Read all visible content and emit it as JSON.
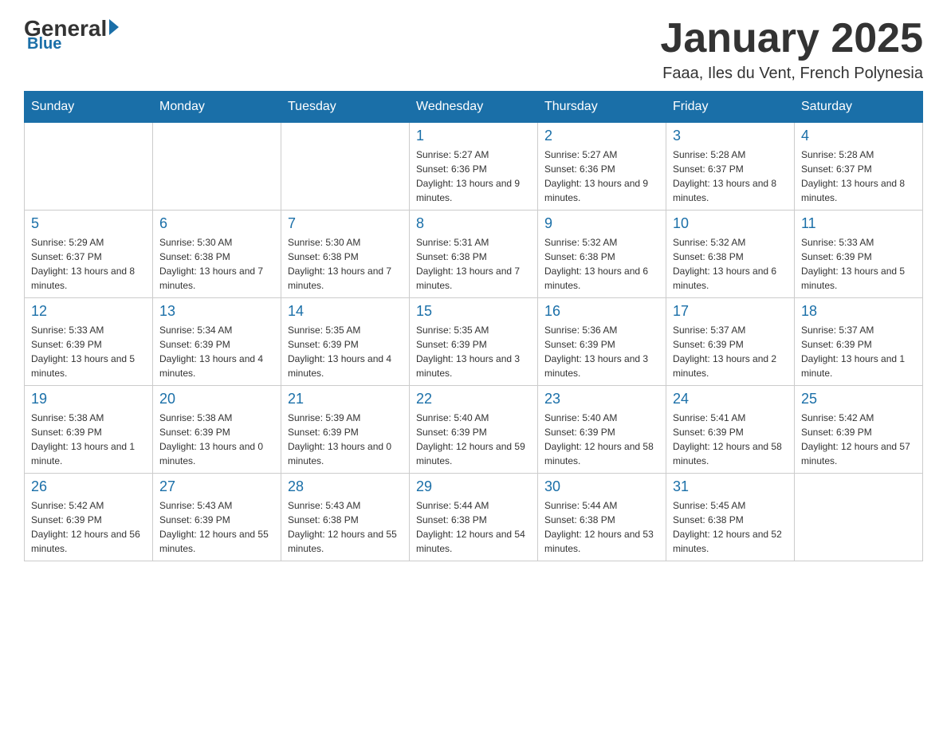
{
  "header": {
    "logo_general": "General",
    "logo_blue": "Blue",
    "month_title": "January 2025",
    "location": "Faaa, Iles du Vent, French Polynesia"
  },
  "days_of_week": [
    "Sunday",
    "Monday",
    "Tuesday",
    "Wednesday",
    "Thursday",
    "Friday",
    "Saturday"
  ],
  "weeks": [
    [
      {
        "day": "",
        "sunrise": "",
        "sunset": "",
        "daylight": ""
      },
      {
        "day": "",
        "sunrise": "",
        "sunset": "",
        "daylight": ""
      },
      {
        "day": "",
        "sunrise": "",
        "sunset": "",
        "daylight": ""
      },
      {
        "day": "1",
        "sunrise": "Sunrise: 5:27 AM",
        "sunset": "Sunset: 6:36 PM",
        "daylight": "Daylight: 13 hours and 9 minutes."
      },
      {
        "day": "2",
        "sunrise": "Sunrise: 5:27 AM",
        "sunset": "Sunset: 6:36 PM",
        "daylight": "Daylight: 13 hours and 9 minutes."
      },
      {
        "day": "3",
        "sunrise": "Sunrise: 5:28 AM",
        "sunset": "Sunset: 6:37 PM",
        "daylight": "Daylight: 13 hours and 8 minutes."
      },
      {
        "day": "4",
        "sunrise": "Sunrise: 5:28 AM",
        "sunset": "Sunset: 6:37 PM",
        "daylight": "Daylight: 13 hours and 8 minutes."
      }
    ],
    [
      {
        "day": "5",
        "sunrise": "Sunrise: 5:29 AM",
        "sunset": "Sunset: 6:37 PM",
        "daylight": "Daylight: 13 hours and 8 minutes."
      },
      {
        "day": "6",
        "sunrise": "Sunrise: 5:30 AM",
        "sunset": "Sunset: 6:38 PM",
        "daylight": "Daylight: 13 hours and 7 minutes."
      },
      {
        "day": "7",
        "sunrise": "Sunrise: 5:30 AM",
        "sunset": "Sunset: 6:38 PM",
        "daylight": "Daylight: 13 hours and 7 minutes."
      },
      {
        "day": "8",
        "sunrise": "Sunrise: 5:31 AM",
        "sunset": "Sunset: 6:38 PM",
        "daylight": "Daylight: 13 hours and 7 minutes."
      },
      {
        "day": "9",
        "sunrise": "Sunrise: 5:32 AM",
        "sunset": "Sunset: 6:38 PM",
        "daylight": "Daylight: 13 hours and 6 minutes."
      },
      {
        "day": "10",
        "sunrise": "Sunrise: 5:32 AM",
        "sunset": "Sunset: 6:38 PM",
        "daylight": "Daylight: 13 hours and 6 minutes."
      },
      {
        "day": "11",
        "sunrise": "Sunrise: 5:33 AM",
        "sunset": "Sunset: 6:39 PM",
        "daylight": "Daylight: 13 hours and 5 minutes."
      }
    ],
    [
      {
        "day": "12",
        "sunrise": "Sunrise: 5:33 AM",
        "sunset": "Sunset: 6:39 PM",
        "daylight": "Daylight: 13 hours and 5 minutes."
      },
      {
        "day": "13",
        "sunrise": "Sunrise: 5:34 AM",
        "sunset": "Sunset: 6:39 PM",
        "daylight": "Daylight: 13 hours and 4 minutes."
      },
      {
        "day": "14",
        "sunrise": "Sunrise: 5:35 AM",
        "sunset": "Sunset: 6:39 PM",
        "daylight": "Daylight: 13 hours and 4 minutes."
      },
      {
        "day": "15",
        "sunrise": "Sunrise: 5:35 AM",
        "sunset": "Sunset: 6:39 PM",
        "daylight": "Daylight: 13 hours and 3 minutes."
      },
      {
        "day": "16",
        "sunrise": "Sunrise: 5:36 AM",
        "sunset": "Sunset: 6:39 PM",
        "daylight": "Daylight: 13 hours and 3 minutes."
      },
      {
        "day": "17",
        "sunrise": "Sunrise: 5:37 AM",
        "sunset": "Sunset: 6:39 PM",
        "daylight": "Daylight: 13 hours and 2 minutes."
      },
      {
        "day": "18",
        "sunrise": "Sunrise: 5:37 AM",
        "sunset": "Sunset: 6:39 PM",
        "daylight": "Daylight: 13 hours and 1 minute."
      }
    ],
    [
      {
        "day": "19",
        "sunrise": "Sunrise: 5:38 AM",
        "sunset": "Sunset: 6:39 PM",
        "daylight": "Daylight: 13 hours and 1 minute."
      },
      {
        "day": "20",
        "sunrise": "Sunrise: 5:38 AM",
        "sunset": "Sunset: 6:39 PM",
        "daylight": "Daylight: 13 hours and 0 minutes."
      },
      {
        "day": "21",
        "sunrise": "Sunrise: 5:39 AM",
        "sunset": "Sunset: 6:39 PM",
        "daylight": "Daylight: 13 hours and 0 minutes."
      },
      {
        "day": "22",
        "sunrise": "Sunrise: 5:40 AM",
        "sunset": "Sunset: 6:39 PM",
        "daylight": "Daylight: 12 hours and 59 minutes."
      },
      {
        "day": "23",
        "sunrise": "Sunrise: 5:40 AM",
        "sunset": "Sunset: 6:39 PM",
        "daylight": "Daylight: 12 hours and 58 minutes."
      },
      {
        "day": "24",
        "sunrise": "Sunrise: 5:41 AM",
        "sunset": "Sunset: 6:39 PM",
        "daylight": "Daylight: 12 hours and 58 minutes."
      },
      {
        "day": "25",
        "sunrise": "Sunrise: 5:42 AM",
        "sunset": "Sunset: 6:39 PM",
        "daylight": "Daylight: 12 hours and 57 minutes."
      }
    ],
    [
      {
        "day": "26",
        "sunrise": "Sunrise: 5:42 AM",
        "sunset": "Sunset: 6:39 PM",
        "daylight": "Daylight: 12 hours and 56 minutes."
      },
      {
        "day": "27",
        "sunrise": "Sunrise: 5:43 AM",
        "sunset": "Sunset: 6:39 PM",
        "daylight": "Daylight: 12 hours and 55 minutes."
      },
      {
        "day": "28",
        "sunrise": "Sunrise: 5:43 AM",
        "sunset": "Sunset: 6:38 PM",
        "daylight": "Daylight: 12 hours and 55 minutes."
      },
      {
        "day": "29",
        "sunrise": "Sunrise: 5:44 AM",
        "sunset": "Sunset: 6:38 PM",
        "daylight": "Daylight: 12 hours and 54 minutes."
      },
      {
        "day": "30",
        "sunrise": "Sunrise: 5:44 AM",
        "sunset": "Sunset: 6:38 PM",
        "daylight": "Daylight: 12 hours and 53 minutes."
      },
      {
        "day": "31",
        "sunrise": "Sunrise: 5:45 AM",
        "sunset": "Sunset: 6:38 PM",
        "daylight": "Daylight: 12 hours and 52 minutes."
      },
      {
        "day": "",
        "sunrise": "",
        "sunset": "",
        "daylight": ""
      }
    ]
  ]
}
